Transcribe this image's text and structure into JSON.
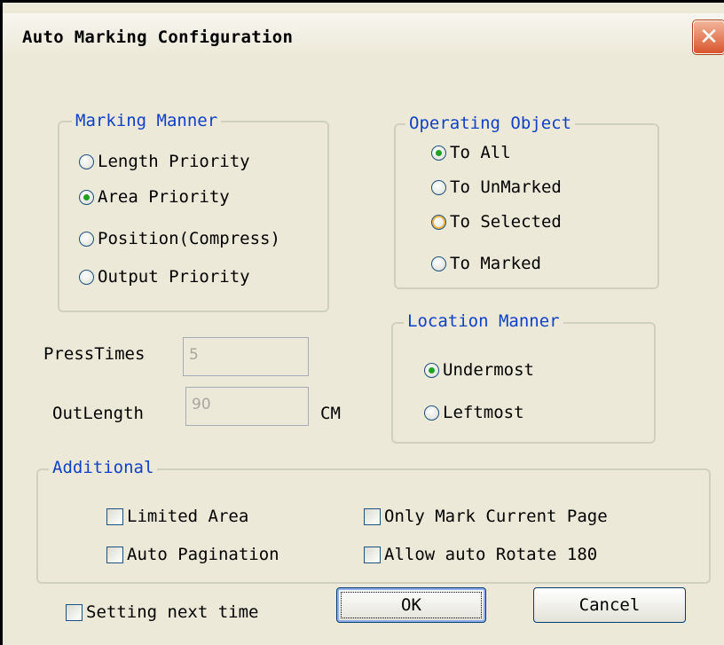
{
  "window": {
    "title": "Auto Marking Configuration",
    "close_label": "✕"
  },
  "marking_manner": {
    "legend": "Marking Manner",
    "options": [
      {
        "label": "Length Priority",
        "selected": false
      },
      {
        "label": "Area Priority",
        "selected": true
      },
      {
        "label": "Position(Compress)",
        "selected": false
      },
      {
        "label": "Output Priority",
        "selected": false
      }
    ]
  },
  "operating_object": {
    "legend": "Operating Object",
    "options": [
      {
        "label": "To All",
        "selected": true
      },
      {
        "label": "To UnMarked",
        "selected": false
      },
      {
        "label": "To Selected",
        "selected": false,
        "hovered": true
      },
      {
        "label": "To Marked",
        "selected": false
      }
    ]
  },
  "location_manner": {
    "legend": "Location Manner",
    "options": [
      {
        "label": "Undermost",
        "selected": true
      },
      {
        "label": "Leftmost",
        "selected": false
      }
    ]
  },
  "fields": {
    "press_times": {
      "label": "PressTimes",
      "value": "5"
    },
    "out_length": {
      "label": "OutLength",
      "value": "90",
      "unit": "CM"
    }
  },
  "additional": {
    "legend": "Additional",
    "limited_area": {
      "label": "Limited Area",
      "checked": false
    },
    "auto_pagination": {
      "label": "Auto Pagination",
      "checked": false
    },
    "only_mark_current_page": {
      "label": "Only Mark Current Page",
      "checked": false
    },
    "allow_auto_rotate": {
      "label": "Allow auto Rotate 180",
      "checked": false
    }
  },
  "footer": {
    "setting_next_time": {
      "label": "Setting next time",
      "checked": false
    },
    "ok_label": "OK",
    "cancel_label": "Cancel"
  },
  "colors": {
    "legend": "#1040c8",
    "radio_dot": "#21a121",
    "close_button": "#d8552d",
    "dialog_bg": "#ece9d8"
  }
}
